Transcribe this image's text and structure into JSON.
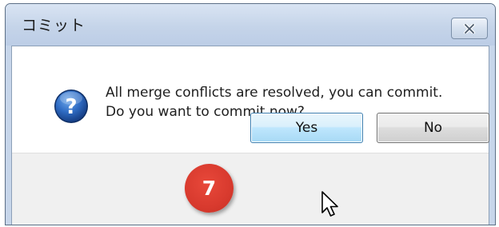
{
  "dialog": {
    "title": "コミット",
    "message_line1": "All merge conflicts are resolved, you can commit.",
    "message_line2": "Do you want to commit now?",
    "icon": "question-icon",
    "buttons": {
      "yes_label": "Yes",
      "no_label": "No"
    }
  },
  "annotation": {
    "step_number": "7",
    "color": "#d83a2e"
  }
}
